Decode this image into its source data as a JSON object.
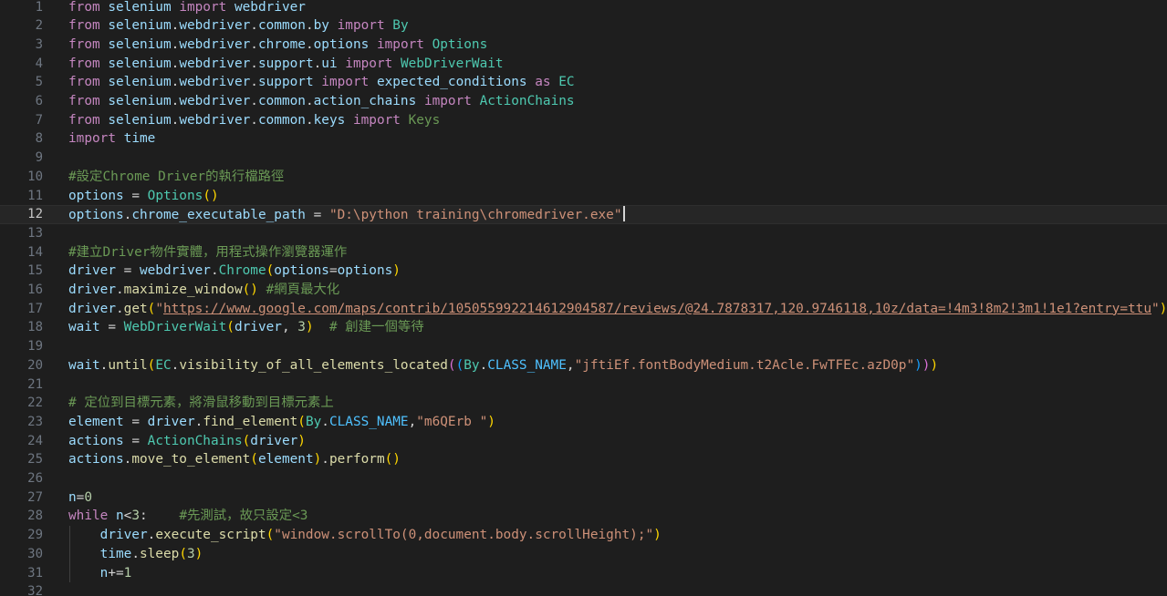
{
  "editor": {
    "active_line": 12,
    "cursor_line": 12,
    "lines": [
      {
        "n": "1",
        "tokens": [
          [
            "from",
            "kw"
          ],
          [
            " ",
            "op"
          ],
          [
            "selenium",
            "id"
          ],
          [
            " ",
            "op"
          ],
          [
            "import",
            "kw"
          ],
          [
            " ",
            "op"
          ],
          [
            "webdriver",
            "id"
          ]
        ]
      },
      {
        "n": "2",
        "tokens": [
          [
            "from",
            "kw"
          ],
          [
            " ",
            "op"
          ],
          [
            "selenium",
            "id"
          ],
          [
            ".",
            "op"
          ],
          [
            "webdriver",
            "id"
          ],
          [
            ".",
            "op"
          ],
          [
            "common",
            "id"
          ],
          [
            ".",
            "op"
          ],
          [
            "by",
            "id"
          ],
          [
            " ",
            "op"
          ],
          [
            "import",
            "kw"
          ],
          [
            " ",
            "op"
          ],
          [
            "By",
            "cl"
          ]
        ]
      },
      {
        "n": "3",
        "tokens": [
          [
            "from",
            "kw"
          ],
          [
            " ",
            "op"
          ],
          [
            "selenium",
            "id"
          ],
          [
            ".",
            "op"
          ],
          [
            "webdriver",
            "id"
          ],
          [
            ".",
            "op"
          ],
          [
            "chrome",
            "id"
          ],
          [
            ".",
            "op"
          ],
          [
            "options",
            "id"
          ],
          [
            " ",
            "op"
          ],
          [
            "import",
            "kw"
          ],
          [
            " ",
            "op"
          ],
          [
            "Options",
            "cl"
          ]
        ]
      },
      {
        "n": "4",
        "tokens": [
          [
            "from",
            "kw"
          ],
          [
            " ",
            "op"
          ],
          [
            "selenium",
            "id"
          ],
          [
            ".",
            "op"
          ],
          [
            "webdriver",
            "id"
          ],
          [
            ".",
            "op"
          ],
          [
            "support",
            "id"
          ],
          [
            ".",
            "op"
          ],
          [
            "ui",
            "id"
          ],
          [
            " ",
            "op"
          ],
          [
            "import",
            "kw"
          ],
          [
            " ",
            "op"
          ],
          [
            "WebDriverWait",
            "cl"
          ]
        ]
      },
      {
        "n": "5",
        "tokens": [
          [
            "from",
            "kw"
          ],
          [
            " ",
            "op"
          ],
          [
            "selenium",
            "id"
          ],
          [
            ".",
            "op"
          ],
          [
            "webdriver",
            "id"
          ],
          [
            ".",
            "op"
          ],
          [
            "support",
            "id"
          ],
          [
            " ",
            "op"
          ],
          [
            "import",
            "kw"
          ],
          [
            " ",
            "op"
          ],
          [
            "expected_conditions",
            "id"
          ],
          [
            " ",
            "op"
          ],
          [
            "as",
            "kw"
          ],
          [
            " ",
            "op"
          ],
          [
            "EC",
            "cl"
          ]
        ]
      },
      {
        "n": "6",
        "tokens": [
          [
            "from",
            "kw"
          ],
          [
            " ",
            "op"
          ],
          [
            "selenium",
            "id"
          ],
          [
            ".",
            "op"
          ],
          [
            "webdriver",
            "id"
          ],
          [
            ".",
            "op"
          ],
          [
            "common",
            "id"
          ],
          [
            ".",
            "op"
          ],
          [
            "action_chains",
            "id"
          ],
          [
            " ",
            "op"
          ],
          [
            "import",
            "kw"
          ],
          [
            " ",
            "op"
          ],
          [
            "ActionChains",
            "cl"
          ]
        ]
      },
      {
        "n": "7",
        "tokens": [
          [
            "from",
            "kw"
          ],
          [
            " ",
            "op"
          ],
          [
            "selenium",
            "id"
          ],
          [
            ".",
            "op"
          ],
          [
            "webdriver",
            "id"
          ],
          [
            ".",
            "op"
          ],
          [
            "common",
            "id"
          ],
          [
            ".",
            "op"
          ],
          [
            "keys",
            "id"
          ],
          [
            " ",
            "op"
          ],
          [
            "import",
            "kw"
          ],
          [
            " ",
            "op"
          ],
          [
            "Keys",
            "cm"
          ]
        ]
      },
      {
        "n": "8",
        "tokens": [
          [
            "import",
            "kw"
          ],
          [
            " ",
            "op"
          ],
          [
            "time",
            "id"
          ]
        ]
      },
      {
        "n": "9",
        "tokens": []
      },
      {
        "n": "10",
        "tokens": [
          [
            "#設定Chrome Driver的執行檔路徑",
            "cm"
          ]
        ]
      },
      {
        "n": "11",
        "tokens": [
          [
            "options",
            "id"
          ],
          [
            " = ",
            "op"
          ],
          [
            "Options",
            "cl"
          ],
          [
            "()",
            "b1"
          ]
        ]
      },
      {
        "n": "12",
        "tokens": [
          [
            "options",
            "id"
          ],
          [
            ".",
            "op"
          ],
          [
            "chrome_executable_path",
            "id"
          ],
          [
            " = ",
            "op"
          ],
          [
            "\"D:\\python training\\chromedriver.exe\"",
            "st"
          ]
        ]
      },
      {
        "n": "13",
        "tokens": []
      },
      {
        "n": "14",
        "tokens": [
          [
            "#建立Driver物件實體，用程式操作瀏覽器運作",
            "cm"
          ]
        ]
      },
      {
        "n": "15",
        "tokens": [
          [
            "driver",
            "id"
          ],
          [
            " = ",
            "op"
          ],
          [
            "webdriver",
            "id"
          ],
          [
            ".",
            "op"
          ],
          [
            "Chrome",
            "cl"
          ],
          [
            "(",
            "b1"
          ],
          [
            "options",
            "id"
          ],
          [
            "=",
            "op"
          ],
          [
            "options",
            "id"
          ],
          [
            ")",
            "b1"
          ]
        ]
      },
      {
        "n": "16",
        "tokens": [
          [
            "driver",
            "id"
          ],
          [
            ".",
            "op"
          ],
          [
            "maximize_window",
            "fn"
          ],
          [
            "()",
            "b1"
          ],
          [
            " ",
            "op"
          ],
          [
            "#網頁最大化",
            "cm"
          ]
        ]
      },
      {
        "n": "17",
        "tokens": [
          [
            "driver",
            "id"
          ],
          [
            ".",
            "op"
          ],
          [
            "get",
            "fn"
          ],
          [
            "(",
            "b1"
          ],
          [
            "\"",
            "st"
          ],
          [
            "https://www.google.com/maps/contrib/105055992214612904587/reviews/@24.7878317,120.9746118,10z/data=!4m3!8m2!3m1!1e1?entry=ttu",
            "url"
          ],
          [
            "\"",
            "st"
          ],
          [
            ")",
            "b1"
          ]
        ]
      },
      {
        "n": "18",
        "tokens": [
          [
            "wait",
            "id"
          ],
          [
            " = ",
            "op"
          ],
          [
            "WebDriverWait",
            "cl"
          ],
          [
            "(",
            "b1"
          ],
          [
            "driver",
            "id"
          ],
          [
            ", ",
            "op"
          ],
          [
            "3",
            "nm"
          ],
          [
            ")",
            "b1"
          ],
          [
            "  ",
            "op"
          ],
          [
            "# 創建一個等待",
            "cm"
          ]
        ]
      },
      {
        "n": "19",
        "tokens": []
      },
      {
        "n": "20",
        "tokens": [
          [
            "wait",
            "id"
          ],
          [
            ".",
            "op"
          ],
          [
            "until",
            "fn"
          ],
          [
            "(",
            "b1"
          ],
          [
            "EC",
            "cl"
          ],
          [
            ".",
            "op"
          ],
          [
            "visibility_of_all_elements_located",
            "fn"
          ],
          [
            "(",
            "b2"
          ],
          [
            "(",
            "b3"
          ],
          [
            "By",
            "cl"
          ],
          [
            ".",
            "op"
          ],
          [
            "CLASS_NAME",
            "cn"
          ],
          [
            ",",
            "op"
          ],
          [
            "\"jftiEf.fontBodyMedium.t2Acle.FwTFEc.azD0p\"",
            "st"
          ],
          [
            ")",
            "b3"
          ],
          [
            ")",
            "b2"
          ],
          [
            ")",
            "b1"
          ]
        ]
      },
      {
        "n": "21",
        "tokens": []
      },
      {
        "n": "22",
        "tokens": [
          [
            "# 定位到目標元素，將滑鼠移動到目標元素上",
            "cm"
          ]
        ]
      },
      {
        "n": "23",
        "tokens": [
          [
            "element",
            "id"
          ],
          [
            " = ",
            "op"
          ],
          [
            "driver",
            "id"
          ],
          [
            ".",
            "op"
          ],
          [
            "find_element",
            "fn"
          ],
          [
            "(",
            "b1"
          ],
          [
            "By",
            "cl"
          ],
          [
            ".",
            "op"
          ],
          [
            "CLASS_NAME",
            "cn"
          ],
          [
            ",",
            "op"
          ],
          [
            "\"m6QErb \"",
            "st"
          ],
          [
            ")",
            "b1"
          ]
        ]
      },
      {
        "n": "24",
        "tokens": [
          [
            "actions",
            "id"
          ],
          [
            " = ",
            "op"
          ],
          [
            "ActionChains",
            "cl"
          ],
          [
            "(",
            "b1"
          ],
          [
            "driver",
            "id"
          ],
          [
            ")",
            "b1"
          ]
        ]
      },
      {
        "n": "25",
        "tokens": [
          [
            "actions",
            "id"
          ],
          [
            ".",
            "op"
          ],
          [
            "move_to_element",
            "fn"
          ],
          [
            "(",
            "b1"
          ],
          [
            "element",
            "id"
          ],
          [
            ")",
            "b1"
          ],
          [
            ".",
            "op"
          ],
          [
            "perform",
            "fn"
          ],
          [
            "()",
            "b1"
          ]
        ]
      },
      {
        "n": "26",
        "tokens": []
      },
      {
        "n": "27",
        "tokens": [
          [
            "n",
            "id"
          ],
          [
            "=",
            "op"
          ],
          [
            "0",
            "nm"
          ]
        ]
      },
      {
        "n": "28",
        "tokens": [
          [
            "while",
            "kw"
          ],
          [
            " ",
            "op"
          ],
          [
            "n",
            "id"
          ],
          [
            "<",
            "op"
          ],
          [
            "3",
            "nm"
          ],
          [
            ":",
            "op"
          ],
          [
            "    ",
            "op"
          ],
          [
            "#先測試，故只設定<3",
            "cm"
          ]
        ]
      },
      {
        "n": "29",
        "tokens": [
          [
            "    ",
            "op"
          ],
          [
            "driver",
            "id"
          ],
          [
            ".",
            "op"
          ],
          [
            "execute_script",
            "fn"
          ],
          [
            "(",
            "b1"
          ],
          [
            "\"window.scrollTo(0,document.body.scrollHeight);\"",
            "st"
          ],
          [
            ")",
            "b1"
          ]
        ]
      },
      {
        "n": "30",
        "tokens": [
          [
            "    ",
            "op"
          ],
          [
            "time",
            "id"
          ],
          [
            ".",
            "op"
          ],
          [
            "sleep",
            "fn"
          ],
          [
            "(",
            "b1"
          ],
          [
            "3",
            "nm"
          ],
          [
            ")",
            "b1"
          ]
        ]
      },
      {
        "n": "31",
        "tokens": [
          [
            "    ",
            "op"
          ],
          [
            "n",
            "id"
          ],
          [
            "+=",
            "op"
          ],
          [
            "1",
            "nm"
          ]
        ]
      },
      {
        "n": "32",
        "tokens": []
      }
    ]
  }
}
